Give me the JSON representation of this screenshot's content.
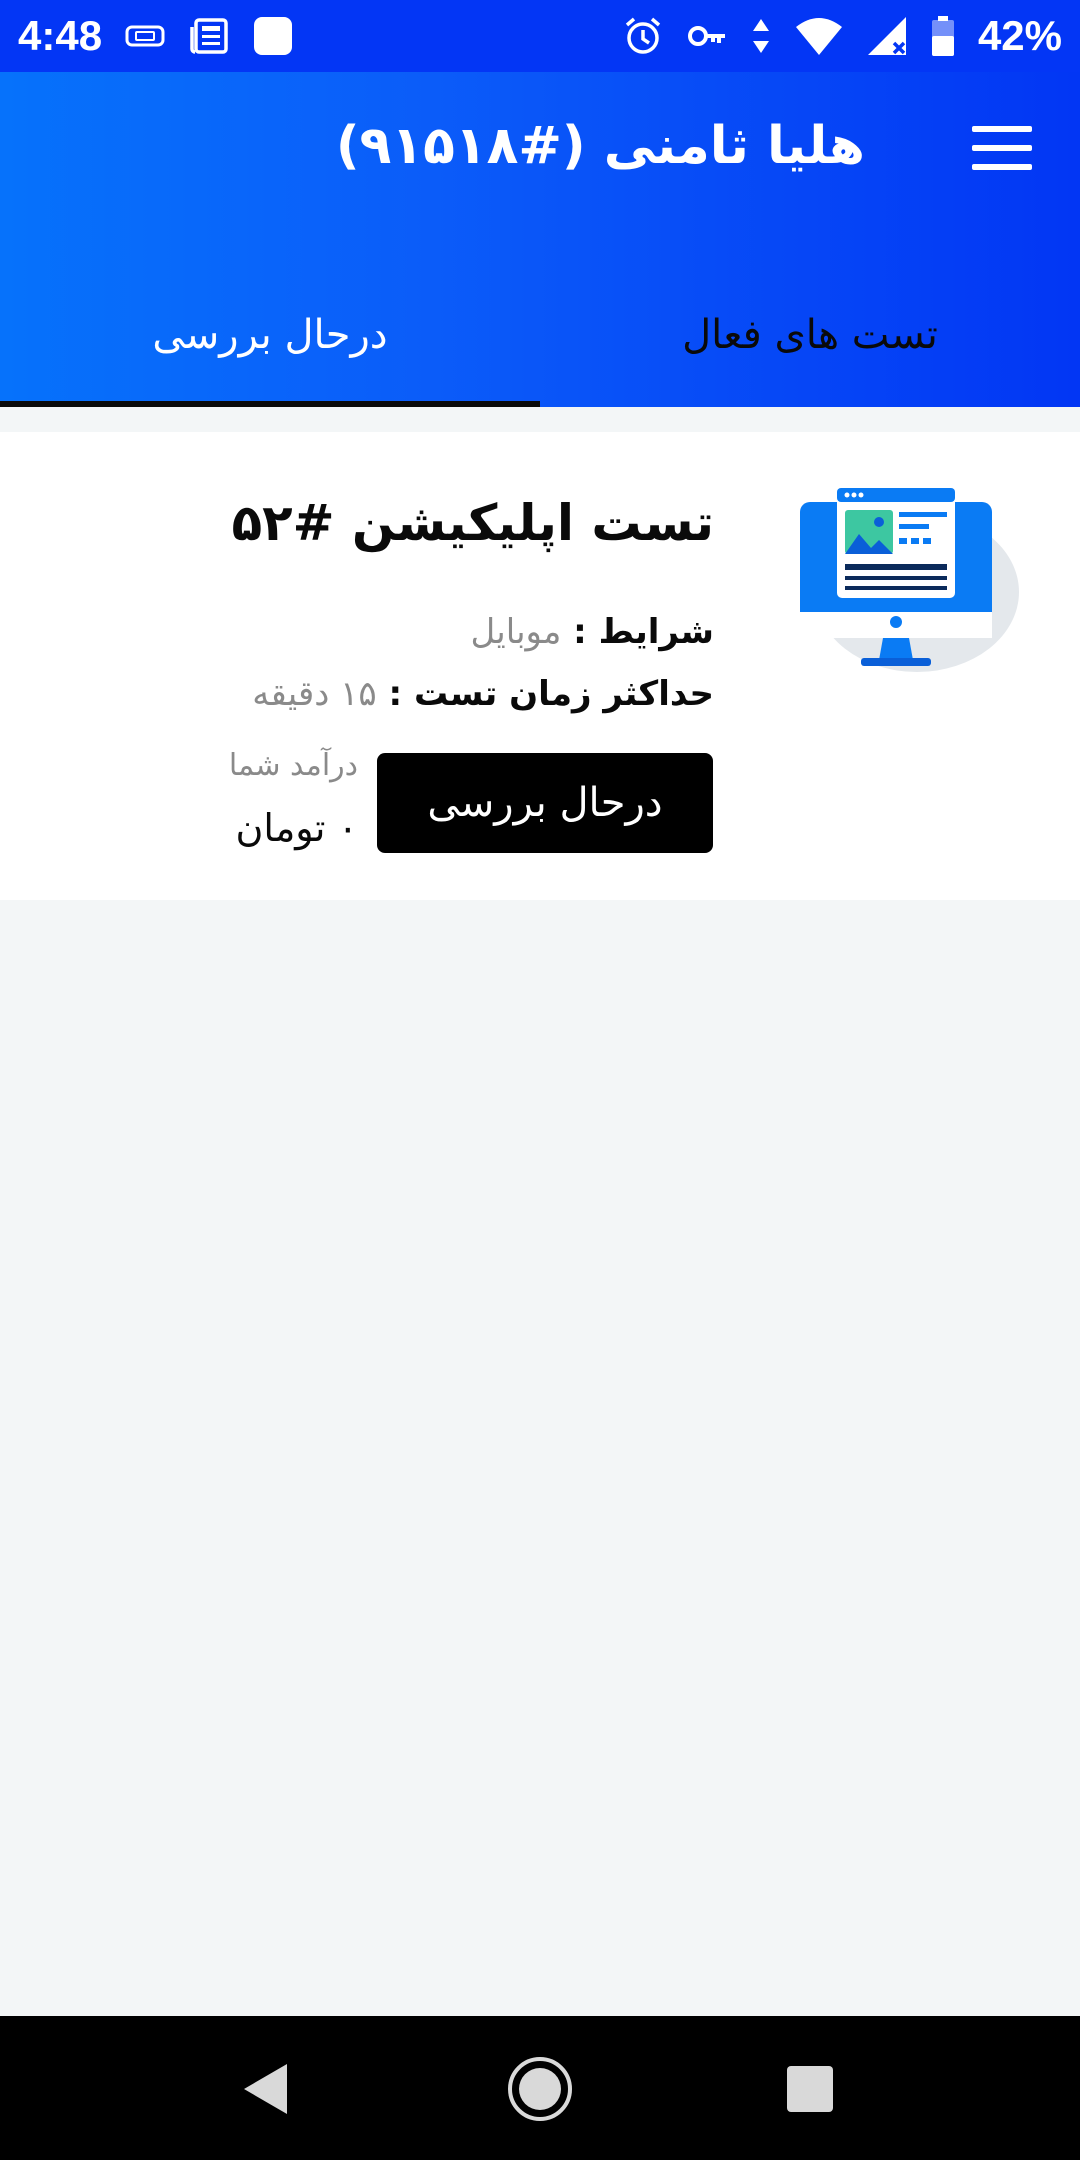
{
  "status_bar": {
    "time": "4:48",
    "battery_percent": "42%",
    "left_icons": [
      "sim-card-icon",
      "news-icon",
      "app-square-icon"
    ],
    "right_icons": [
      "alarm-icon",
      "vpn-key-icon",
      "data-arrows-icon",
      "wifi-icon",
      "signal-icon",
      "battery-icon"
    ]
  },
  "header": {
    "title": "هلیا ثامنی (#۹۱۵۱۸)",
    "menu_icon": "hamburger-menu-icon",
    "gradient_colors": [
      "#0672fb",
      "#0236f4"
    ]
  },
  "tabs": [
    {
      "label": "تست های فعال",
      "active": false
    },
    {
      "label": "درحال بررسی",
      "active": true
    }
  ],
  "card": {
    "title": "تست اپلیکیشن #۵۲",
    "illustration": "desktop-monitor-icon",
    "conditions_label": "شرایط : ",
    "conditions_value": "موبایل",
    "max_time_label": "حداکثر زمان تست : ",
    "max_time_value": "۱۵ دقیقه",
    "status_button_label": "درحال بررسی",
    "income_label": "درآمد شما",
    "income_value": "۰ تومان"
  },
  "nav_bar": {
    "buttons": [
      "back-icon",
      "home-icon",
      "recents-icon"
    ]
  },
  "colors": {
    "status_bar": "#0336f5",
    "accent": "#0b5cf9",
    "button": "#000000",
    "background": "#f3f6f7"
  }
}
